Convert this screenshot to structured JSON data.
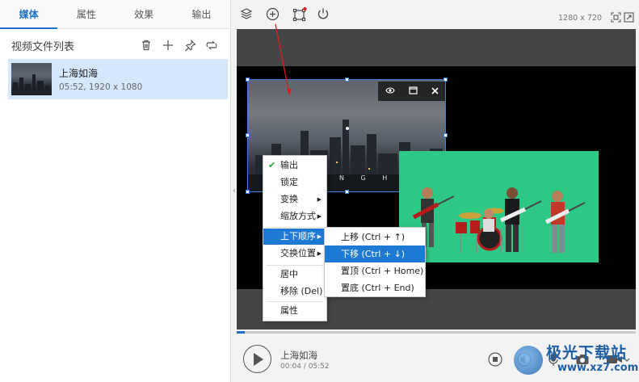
{
  "tabs": [
    {
      "label": "媒体",
      "active": true
    },
    {
      "label": "属性",
      "active": false
    },
    {
      "label": "效果",
      "active": false
    },
    {
      "label": "输出",
      "active": false
    }
  ],
  "file_list": {
    "title": "视频文件列表",
    "toolbar_icons": [
      "trash-icon",
      "plus-icon",
      "pin-icon",
      "loop-icon"
    ],
    "items": [
      {
        "name": "上海如海",
        "meta": "05:52, 1920 x 1080",
        "selected": true
      }
    ]
  },
  "toolbar": {
    "icons": [
      "layers-icon",
      "add-circle-icon",
      "crop-icon",
      "power-icon"
    ],
    "resolution": "1280 x 720"
  },
  "canvas": {
    "overlay_text": "N G H A I"
  },
  "context_menu": {
    "items": [
      {
        "label": "输出",
        "checked": true,
        "submenu": false
      },
      {
        "label": "锁定",
        "checked": false,
        "submenu": false
      },
      {
        "label": "变换",
        "checked": false,
        "submenu": true
      },
      {
        "label": "缩放方式",
        "checked": false,
        "submenu": true
      },
      {
        "label": "上下顺序",
        "checked": false,
        "submenu": true,
        "highlighted": true
      },
      {
        "label": "交换位置",
        "checked": false,
        "submenu": true
      },
      {
        "label": "居中",
        "checked": false,
        "submenu": false
      },
      {
        "label": "移除 (Del)",
        "checked": false,
        "submenu": false
      },
      {
        "label": "属性",
        "checked": false,
        "submenu": false
      }
    ],
    "submenu": [
      {
        "label": "上移  (Ctrl + ↑)"
      },
      {
        "label": "下移  (Ctrl + ↓)",
        "highlighted": true
      },
      {
        "label": "置顶  (Ctrl + Home)"
      },
      {
        "label": "置底  (Ctrl + End)"
      }
    ]
  },
  "player": {
    "name": "上海如海",
    "time": "00:04 / 05:52",
    "progress": 0.02
  },
  "watermark": {
    "title": "极光下载站",
    "url": "www.xz7.com"
  },
  "colors": {
    "accent": "#1e6fcc",
    "menu_highlight": "#1d79d2",
    "green_screen": "#2ec886",
    "selection": "#3f7fdc",
    "arrow": "#d62020"
  }
}
